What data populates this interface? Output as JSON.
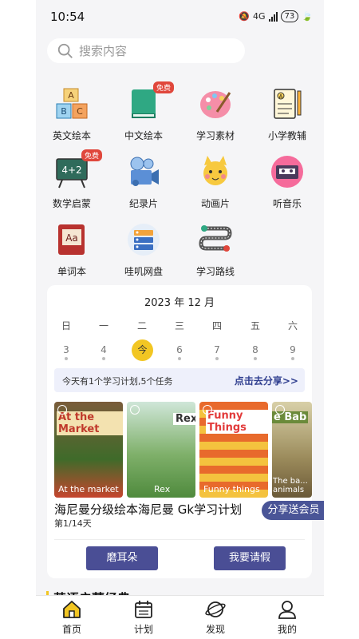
{
  "status_bar": {
    "time": "10:54",
    "network": "4G",
    "battery": "73"
  },
  "search": {
    "placeholder": "搜索内容"
  },
  "grid_items": [
    {
      "label": "英文绘本",
      "icon": "abc-blocks-icon"
    },
    {
      "label": "中文绘本",
      "icon": "book-icon",
      "badge": "免费"
    },
    {
      "label": "学习素材",
      "icon": "palette-icon"
    },
    {
      "label": "小学教辅",
      "icon": "exam-paper-icon"
    },
    {
      "label": "数学启蒙",
      "icon": "blackboard-icon",
      "badge": "免费",
      "board_text": "4+2"
    },
    {
      "label": "纪录片",
      "icon": "film-camera-icon"
    },
    {
      "label": "动画片",
      "icon": "cartoon-cat-icon"
    },
    {
      "label": "听音乐",
      "icon": "cassette-icon"
    },
    {
      "label": "单词本",
      "icon": "dictionary-icon",
      "cover_text": "Aa"
    },
    {
      "label": "哇叽网盘",
      "icon": "server-icon"
    },
    {
      "label": "学习路线",
      "icon": "route-icon"
    }
  ],
  "calendar": {
    "month": "2023 年 12 月",
    "weekdays": [
      "日",
      "一",
      "二",
      "三",
      "四",
      "五",
      "六"
    ],
    "dates": [
      "3",
      "4",
      "今",
      "6",
      "7",
      "8",
      "9"
    ],
    "today_index": 2,
    "accent": "#f2c623"
  },
  "plan": {
    "summary": "今天有1个学习计划,5个任务",
    "share_link": "点击去分享>>",
    "books": [
      {
        "title": "At the market",
        "cover": "At the Market"
      },
      {
        "title": "Rex",
        "cover": "Rex"
      },
      {
        "title": "Funny things",
        "cover": "Funny Things"
      },
      {
        "title": "The ba... animals",
        "cover": "e Bab"
      }
    ],
    "title": "海尼曼分级绘本海尼曼 Gk学习计划",
    "day": "第1/14天",
    "share_badge": "分享送会员",
    "buttons": {
      "left": "磨耳朵",
      "right": "我要请假"
    }
  },
  "section": {
    "title": "英语启蒙经典"
  },
  "tabbar": [
    {
      "label": "首页",
      "icon": "home-icon"
    },
    {
      "label": "计划",
      "icon": "calendar-icon"
    },
    {
      "label": "发现",
      "icon": "planet-icon"
    },
    {
      "label": "我的",
      "icon": "user-icon"
    }
  ],
  "colors": {
    "primary": "#4a4e95",
    "accent": "#f2c623",
    "badge": "#e0473c"
  }
}
